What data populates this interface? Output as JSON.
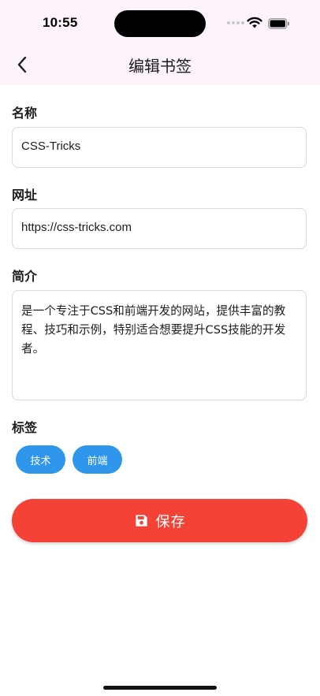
{
  "status_bar": {
    "time": "10:55"
  },
  "app_bar": {
    "title": "编辑书签",
    "back_icon": "chevron-left-icon"
  },
  "form": {
    "name": {
      "label": "名称",
      "value": "CSS-Tricks"
    },
    "url": {
      "label": "网址",
      "value": "https://css-tricks.com"
    },
    "description": {
      "label": "简介",
      "value": "是一个专注于CSS和前端开发的网站，提供丰富的教程、技巧和示例，特别适合想要提升CSS技能的开发者。"
    },
    "tags": {
      "label": "标签",
      "items": [
        "技术",
        "前端"
      ]
    }
  },
  "save_button": {
    "label": "保存",
    "icon": "save-icon"
  },
  "colors": {
    "app_bar_bg": "#fdf3fb",
    "chip_bg": "#2f96eb",
    "save_bg": "#f44336",
    "border": "#d9d9d9"
  }
}
